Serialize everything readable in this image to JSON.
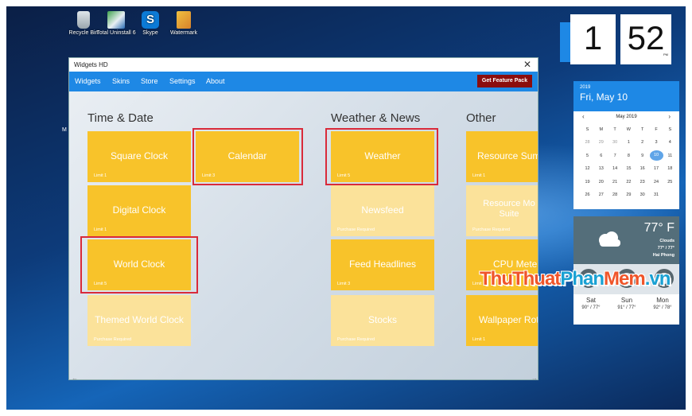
{
  "desktop": {
    "icons": [
      {
        "label": "Recycle Bin",
        "icon": "recycle-bin-icon"
      },
      {
        "label": "Total Uninstall 6",
        "icon": "uninstall-icon"
      },
      {
        "label": "Skype",
        "icon": "skype-icon"
      },
      {
        "label": "Watermark",
        "icon": "watermark-icon"
      }
    ],
    "side_text": "M"
  },
  "window": {
    "title": "Widgets HD",
    "close": "✕",
    "nav": [
      "Widgets",
      "Skins",
      "Store",
      "Settings",
      "About"
    ],
    "feature_button": "Get Feature Pack",
    "scroll_left": "←",
    "scroll_right": "→",
    "sections": {
      "time_date": "Time & Date",
      "weather_news": "Weather & News",
      "other": "Other"
    },
    "tiles": [
      {
        "name": "Square Clock",
        "sub": "Limit 1",
        "pale": false
      },
      {
        "name": "Calendar",
        "sub": "Limit 3",
        "pale": false
      },
      {
        "name": "Digital Clock",
        "sub": "Limit 1",
        "pale": false
      },
      {
        "name": "World Clock",
        "sub": "Limit 5",
        "pale": false
      },
      {
        "name": "Themed World Clock",
        "sub": "Purchase Required",
        "pale": true
      },
      {
        "name": "Weather",
        "sub": "Limit 5",
        "pale": false
      },
      {
        "name": "Newsfeed",
        "sub": "Purchase Required",
        "pale": true
      },
      {
        "name": "Feed Headlines",
        "sub": "Limit 3",
        "pale": false
      },
      {
        "name": "Stocks",
        "sub": "Purchase Required",
        "pale": true
      },
      {
        "name": "Resource Sum",
        "sub": "Limit 1",
        "pale": false
      },
      {
        "name": "Resource Mo Suite",
        "sub": "Purchase Required",
        "pale": true
      },
      {
        "name": "CPU Mete",
        "sub": "Limit 1",
        "pale": false
      },
      {
        "name": "Wallpaper Rot",
        "sub": "Limit 1",
        "pale": false
      }
    ]
  },
  "clock": {
    "hour": "1",
    "minute": "52",
    "ampm": "PM"
  },
  "calendar": {
    "year": "2019",
    "date": "Fri, May 10",
    "month": "May 2019",
    "prev": "‹",
    "next": "›",
    "weekdays": [
      "S",
      "M",
      "T",
      "W",
      "T",
      "F",
      "S"
    ],
    "cells": [
      "28",
      "29",
      "30",
      "1",
      "2",
      "3",
      "4",
      "5",
      "6",
      "7",
      "8",
      "9",
      "10",
      "11",
      "12",
      "13",
      "14",
      "15",
      "16",
      "17",
      "18",
      "19",
      "20",
      "21",
      "22",
      "23",
      "24",
      "25",
      "26",
      "27",
      "28",
      "29",
      "30",
      "31",
      ""
    ],
    "selected": "10"
  },
  "weather": {
    "temp": "77° F",
    "condition": "Clouds",
    "range": "77° / 77°",
    "city": "Hai Phong",
    "forecast": [
      {
        "day": "Sat",
        "temp": "90° / 77°"
      },
      {
        "day": "Sun",
        "temp": "91° / 77°"
      },
      {
        "day": "Mon",
        "temp": "92° / 78°"
      }
    ]
  },
  "watermark": {
    "part1": "ThuThuat",
    "part2": "Phan",
    "part3": "Mem",
    "part4": ".vn"
  },
  "colors": {
    "accent": "#1e88e5",
    "tile": "#f8c32a",
    "tile_pale": "#fbe29a",
    "highlight": "#d92a3a",
    "feature_button": "#8b0d0d"
  }
}
